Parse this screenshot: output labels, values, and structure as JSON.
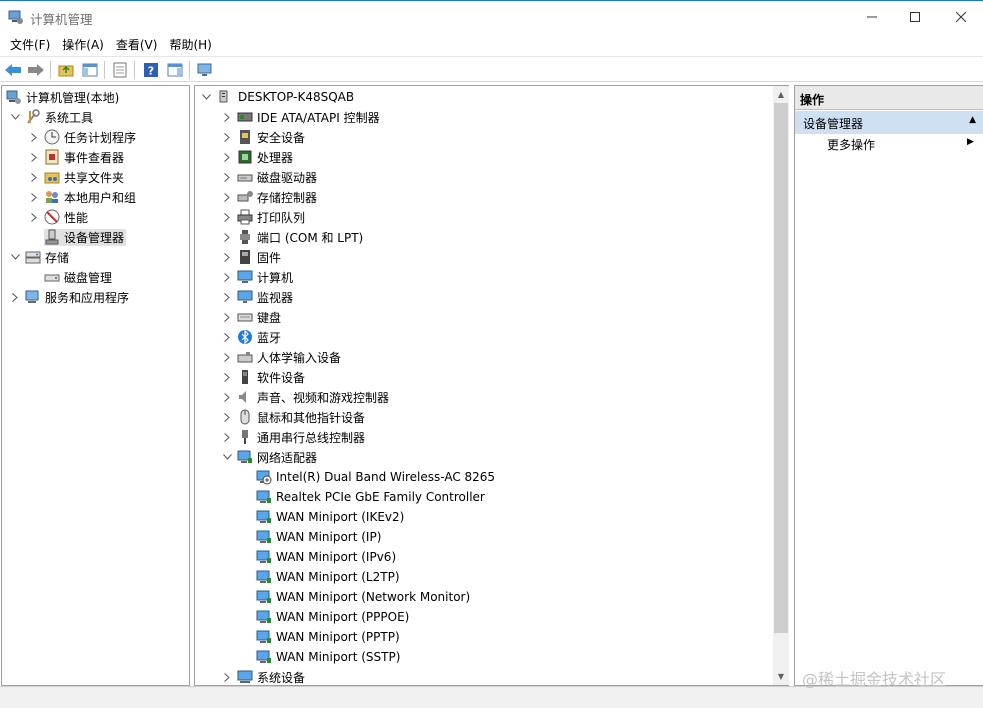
{
  "window": {
    "title": "计算机管理"
  },
  "menu": [
    "文件(F)",
    "操作(A)",
    "查看(V)",
    "帮助(H)"
  ],
  "left_tree": [
    {
      "label": "计算机管理(本地)",
      "level": 0,
      "expander": "none",
      "icon": "computer-management-icon"
    },
    {
      "label": "系统工具",
      "level": 1,
      "expander": "open",
      "icon": "tools-icon"
    },
    {
      "label": "任务计划程序",
      "level": 2,
      "expander": "closed",
      "icon": "clock-icon"
    },
    {
      "label": "事件查看器",
      "level": 2,
      "expander": "closed",
      "icon": "event-viewer-icon"
    },
    {
      "label": "共享文件夹",
      "level": 2,
      "expander": "closed",
      "icon": "shared-folder-icon"
    },
    {
      "label": "本地用户和组",
      "level": 2,
      "expander": "closed",
      "icon": "users-icon"
    },
    {
      "label": "性能",
      "level": 2,
      "expander": "closed",
      "icon": "performance-icon"
    },
    {
      "label": "设备管理器",
      "level": 2,
      "expander": "none",
      "icon": "device-manager-icon",
      "selected": true
    },
    {
      "label": "存储",
      "level": 1,
      "expander": "open",
      "icon": "storage-icon"
    },
    {
      "label": "磁盘管理",
      "level": 2,
      "expander": "none",
      "icon": "disk-management-icon"
    },
    {
      "label": "服务和应用程序",
      "level": 1,
      "expander": "closed",
      "icon": "services-icon"
    }
  ],
  "device_tree": {
    "root": "DESKTOP-K48SQAB",
    "items": [
      {
        "label": "IDE ATA/ATAPI 控制器",
        "level": 1,
        "expander": "closed",
        "icon": "ide-controller-icon"
      },
      {
        "label": "安全设备",
        "level": 1,
        "expander": "closed",
        "icon": "security-device-icon"
      },
      {
        "label": "处理器",
        "level": 1,
        "expander": "closed",
        "icon": "processor-icon"
      },
      {
        "label": "磁盘驱动器",
        "level": 1,
        "expander": "closed",
        "icon": "disk-drive-icon"
      },
      {
        "label": "存储控制器",
        "level": 1,
        "expander": "closed",
        "icon": "storage-controller-icon"
      },
      {
        "label": "打印队列",
        "level": 1,
        "expander": "closed",
        "icon": "printer-icon"
      },
      {
        "label": "端口 (COM 和 LPT)",
        "level": 1,
        "expander": "closed",
        "icon": "port-icon"
      },
      {
        "label": "固件",
        "level": 1,
        "expander": "closed",
        "icon": "firmware-icon"
      },
      {
        "label": "计算机",
        "level": 1,
        "expander": "closed",
        "icon": "computer-icon"
      },
      {
        "label": "监视器",
        "level": 1,
        "expander": "closed",
        "icon": "monitor-icon"
      },
      {
        "label": "键盘",
        "level": 1,
        "expander": "closed",
        "icon": "keyboard-icon"
      },
      {
        "label": "蓝牙",
        "level": 1,
        "expander": "closed",
        "icon": "bluetooth-icon"
      },
      {
        "label": "人体学输入设备",
        "level": 1,
        "expander": "closed",
        "icon": "hid-icon"
      },
      {
        "label": "软件设备",
        "level": 1,
        "expander": "closed",
        "icon": "software-device-icon"
      },
      {
        "label": "声音、视频和游戏控制器",
        "level": 1,
        "expander": "closed",
        "icon": "sound-icon"
      },
      {
        "label": "鼠标和其他指针设备",
        "level": 1,
        "expander": "closed",
        "icon": "mouse-icon"
      },
      {
        "label": "通用串行总线控制器",
        "level": 1,
        "expander": "closed",
        "icon": "usb-icon"
      },
      {
        "label": "网络适配器",
        "level": 1,
        "expander": "open",
        "icon": "network-adapter-icon"
      },
      {
        "label": "Intel(R) Dual Band Wireless-AC 8265",
        "level": 2,
        "expander": "none",
        "icon": "network-adapter-warning-icon"
      },
      {
        "label": "Realtek PCIe GbE Family Controller",
        "level": 2,
        "expander": "none",
        "icon": "network-adapter-icon"
      },
      {
        "label": "WAN Miniport (IKEv2)",
        "level": 2,
        "expander": "none",
        "icon": "network-adapter-icon"
      },
      {
        "label": "WAN Miniport (IP)",
        "level": 2,
        "expander": "none",
        "icon": "network-adapter-icon"
      },
      {
        "label": "WAN Miniport (IPv6)",
        "level": 2,
        "expander": "none",
        "icon": "network-adapter-icon"
      },
      {
        "label": "WAN Miniport (L2TP)",
        "level": 2,
        "expander": "none",
        "icon": "network-adapter-icon"
      },
      {
        "label": "WAN Miniport (Network Monitor)",
        "level": 2,
        "expander": "none",
        "icon": "network-adapter-icon"
      },
      {
        "label": "WAN Miniport (PPPOE)",
        "level": 2,
        "expander": "none",
        "icon": "network-adapter-icon"
      },
      {
        "label": "WAN Miniport (PPTP)",
        "level": 2,
        "expander": "none",
        "icon": "network-adapter-icon"
      },
      {
        "label": "WAN Miniport (SSTP)",
        "level": 2,
        "expander": "none",
        "icon": "network-adapter-icon"
      },
      {
        "label": "系统设备",
        "level": 1,
        "expander": "closed",
        "icon": "system-device-icon"
      }
    ]
  },
  "actions": {
    "title": "操作",
    "section": "设备管理器",
    "more": "更多操作"
  },
  "watermark": "@稀土掘金技术社区"
}
